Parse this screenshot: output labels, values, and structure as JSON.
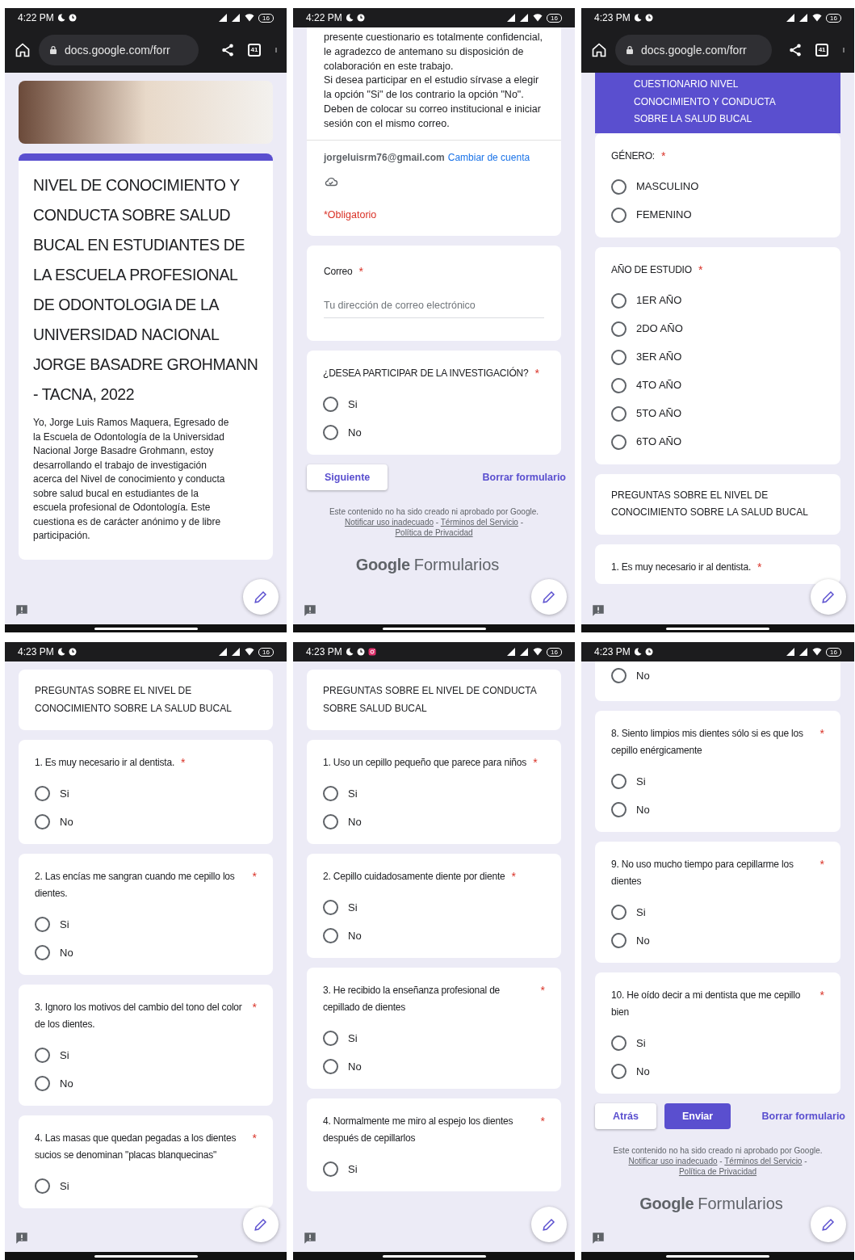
{
  "panels": [
    {
      "status_bar": {
        "time": "4:22 PM",
        "battery": "16"
      },
      "browser": {
        "url": "docs.google.com/forr",
        "tabs": "41"
      },
      "blocks": [
        {
          "kind": "header_image"
        },
        {
          "kind": "title_card",
          "title": "NIVEL DE CONOCIMIENTO Y CONDUCTA SOBRE SALUD BUCAL EN ESTUDIANTES DE LA ESCUELA PROFESIONAL DE ODONTOLOGIA DE LA UNIVERSIDAD NACIONAL JORGE BASADRE GROHMANN - TACNA, 2022",
          "description": "Yo, Jorge Luis Ramos Maquera, Egresado de la Escuela de Odontología de la Universidad Nacional Jorge Basadre Grohmann, estoy desarrollando el trabajo de investigación acerca del Nivel de conocimiento y conducta sobre salud bucal en estudiantes de la escuela profesional de Odontología. Este cuestiona es de carácter anónimo y de libre participación."
        }
      ]
    },
    {
      "status_bar": {
        "time": "4:22 PM",
        "battery": "16"
      },
      "blocks": [
        {
          "kind": "intro_continued",
          "text": "presente cuestionario es totalmente confidencial, le agradezco de antemano su disposición de colaboración en este trabajo.\nSi desea participar en el estudio sírvase a elegir la opción \"Si\" de los contrario la opción \"No\".\nDeben de colocar su correo institucional e iniciar sesión con el mismo correo.",
          "account": "jorgeluisrm76@gmail.com",
          "switch_link": "Cambiar de cuenta",
          "required_note": "*Obligatorio"
        },
        {
          "kind": "email_question",
          "title": "Correo",
          "required_mark": "*",
          "placeholder": "Tu dirección de correo electrónico"
        },
        {
          "kind": "question",
          "title": "¿DESEA PARTICIPAR DE LA INVESTIGACIÓN?",
          "required_mark": "*",
          "options": [
            {
              "label": "Si",
              "selected": false
            },
            {
              "label": "No",
              "selected": false
            }
          ]
        },
        {
          "kind": "actions",
          "buttons": [
            {
              "label": "Siguiente",
              "kind": "secondary"
            },
            {
              "label": "Borrar formulario",
              "kind": "link"
            }
          ]
        },
        {
          "kind": "footer",
          "notice": "Este contenido no ha sido creado ni aprobado por Google.",
          "links": [
            "Notificar uso inadecuado",
            "Términos del Servicio",
            "Política de Privacidad"
          ],
          "separator": "-"
        },
        {
          "kind": "brand",
          "company": "Google",
          "product": "Formularios"
        }
      ]
    },
    {
      "status_bar": {
        "time": "4:23 PM",
        "battery": "16"
      },
      "browser": {
        "url": "docs.google.com/forr",
        "tabs": "41"
      },
      "blocks": [
        {
          "kind": "banner",
          "text": "CUESTIONARIO NIVEL CONOCIMIENTO Y CONDUCTA SOBRE LA SALUD BUCAL"
        },
        {
          "kind": "question",
          "title": "GÉNERO:",
          "required_mark": "*",
          "options": [
            {
              "label": "MASCULINO",
              "selected": false
            },
            {
              "label": "FEMENINO",
              "selected": false
            }
          ]
        },
        {
          "kind": "question",
          "title": "AÑO DE ESTUDIO",
          "required_mark": "*",
          "options": [
            {
              "label": "1ER AÑO",
              "selected": false
            },
            {
              "label": "2DO AÑO",
              "selected": false
            },
            {
              "label": "3ER AÑO",
              "selected": false
            },
            {
              "label": "4TO AÑO",
              "selected": false
            },
            {
              "label": "5TO AÑO",
              "selected": false
            },
            {
              "label": "6TO AÑO",
              "selected": false
            }
          ]
        },
        {
          "kind": "section",
          "text": "PREGUNTAS SOBRE EL NIVEL DE CONOCIMIENTO SOBRE LA SALUD BUCAL"
        },
        {
          "kind": "question",
          "title": "1. Es muy necesario ir al dentista.",
          "required_mark": "*"
        }
      ]
    },
    {
      "status_bar": {
        "time": "4:23 PM",
        "battery": "16"
      },
      "blocks": [
        {
          "kind": "section",
          "text": "PREGUNTAS SOBRE EL NIVEL DE CONOCIMIENTO SOBRE LA SALUD BUCAL"
        },
        {
          "kind": "question",
          "title": "1. Es muy necesario ir al dentista.",
          "required_mark": "*",
          "options": [
            {
              "label": "Si",
              "selected": false
            },
            {
              "label": "No",
              "selected": false
            }
          ]
        },
        {
          "kind": "question",
          "title": "2. Las encías me sangran cuando me cepillo los dientes.",
          "required_mark": "*",
          "options": [
            {
              "label": "Si",
              "selected": false
            },
            {
              "label": "No",
              "selected": false
            }
          ]
        },
        {
          "kind": "question",
          "title": "3. Ignoro los motivos del cambio del tono del color de los dientes.",
          "required_mark": "*",
          "options": [
            {
              "label": "Si",
              "selected": false
            },
            {
              "label": "No",
              "selected": false
            }
          ]
        },
        {
          "kind": "question",
          "title": "4. Las masas que quedan pegadas a los dientes sucios se denominan \"placas blanquecinas\"",
          "required_mark": "*",
          "options": [
            {
              "label": "Si",
              "selected": false
            }
          ]
        }
      ]
    },
    {
      "status_bar": {
        "time": "4:23 PM",
        "app_notification": true,
        "battery": "16"
      },
      "blocks": [
        {
          "kind": "section",
          "text": "PREGUNTAS SOBRE EL NIVEL DE CONDUCTA SOBRE SALUD BUCAL"
        },
        {
          "kind": "question",
          "title": "1. Uso un cepillo pequeño que parece para niños",
          "required_mark": "*",
          "options": [
            {
              "label": "Si",
              "selected": false
            },
            {
              "label": "No",
              "selected": false
            }
          ]
        },
        {
          "kind": "question",
          "title": "2. Cepillo cuidadosamente diente por diente",
          "required_mark": "*",
          "options": [
            {
              "label": "Si",
              "selected": false
            },
            {
              "label": "No",
              "selected": false
            }
          ]
        },
        {
          "kind": "question",
          "title": "3. He recibido la enseñanza profesional de cepillado de dientes",
          "required_mark": "*",
          "options": [
            {
              "label": "Si",
              "selected": false
            },
            {
              "label": "No",
              "selected": false
            }
          ]
        },
        {
          "kind": "question",
          "title": "4. Normalmente me miro al espejo los dientes después de cepillarlos",
          "required_mark": "*",
          "options": [
            {
              "label": "Si",
              "selected": false
            }
          ]
        }
      ]
    },
    {
      "status_bar": {
        "time": "4:23 PM",
        "battery": "16"
      },
      "blocks": [
        {
          "kind": "options_continued",
          "options": [
            {
              "label": "No",
              "selected": false
            }
          ]
        },
        {
          "kind": "question",
          "title": "8. Siento limpios mis dientes sólo si es que los cepillo enérgicamente",
          "required_mark": "*",
          "options": [
            {
              "label": "Si",
              "selected": false
            },
            {
              "label": "No",
              "selected": false
            }
          ]
        },
        {
          "kind": "question",
          "title": "9. No uso mucho tiempo para cepillarme los dientes",
          "required_mark": "*",
          "options": [
            {
              "label": "Si",
              "selected": false
            },
            {
              "label": "No",
              "selected": false
            }
          ]
        },
        {
          "kind": "question",
          "title": "10. He oído decir a mi dentista que me cepillo bien",
          "required_mark": "*",
          "options": [
            {
              "label": "Si",
              "selected": false
            },
            {
              "label": "No",
              "selected": false
            }
          ]
        },
        {
          "kind": "actions",
          "buttons": [
            {
              "label": "Atrás",
              "kind": "secondary"
            },
            {
              "label": "Enviar",
              "kind": "primary"
            },
            {
              "label": "Borrar formulario",
              "kind": "link"
            }
          ]
        },
        {
          "kind": "footer",
          "notice": "Este contenido no ha sido creado ni aprobado por Google.",
          "links": [
            "Notificar uso inadecuado",
            "Términos del Servicio",
            "Política de Privacidad"
          ],
          "separator": "-"
        },
        {
          "kind": "brand",
          "company": "Google",
          "product": "Formularios"
        }
      ]
    }
  ]
}
